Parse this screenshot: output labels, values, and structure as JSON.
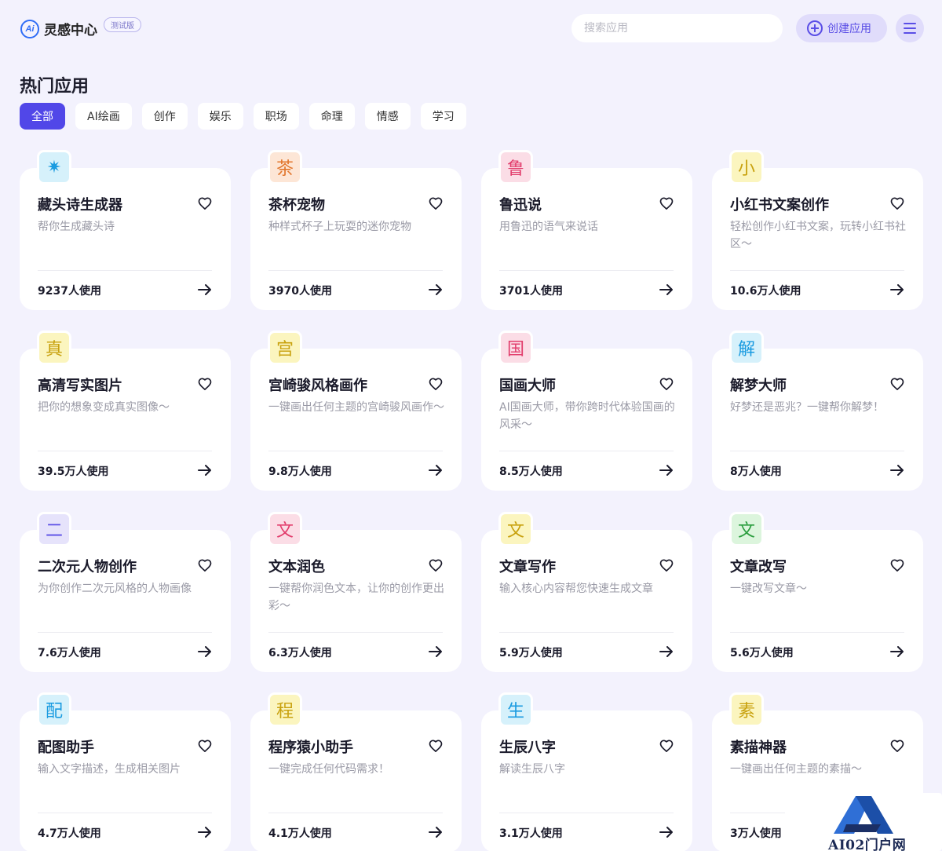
{
  "header": {
    "logo_mark": "Ai",
    "app_title": "灵感中心",
    "beta_badge": "测试版",
    "search_placeholder": "搜索应用",
    "create_button": "创建应用",
    "menu_icon": "hamburger-menu-icon"
  },
  "section_title": "热门应用",
  "tabs": [
    "全部",
    "AI绘画",
    "创作",
    "娱乐",
    "职场",
    "命理",
    "情感",
    "学习"
  ],
  "active_tab": "全部",
  "cards": [
    {
      "icon": "✷",
      "icon_color": "#1a9be0",
      "icon_bg": "#d6f1fb",
      "title": "藏头诗生成器",
      "desc": "帮你生成藏头诗",
      "usage": "9237人使用"
    },
    {
      "icon": "茶",
      "icon_color": "#e2772e",
      "icon_bg": "#fde6d6",
      "title": "茶杯宠物",
      "desc": "种样式杯子上玩耍的迷你宠物",
      "usage": "3970人使用"
    },
    {
      "icon": "鲁",
      "icon_color": "#e23d6c",
      "icon_bg": "#fbdde6",
      "title": "鲁迅说",
      "desc": "用鲁迅的语气来说话",
      "usage": "3701人使用"
    },
    {
      "icon": "小",
      "icon_color": "#c8a10e",
      "icon_bg": "#fbf5bf",
      "title": "小红书文案创作",
      "desc": "轻松创作小红书文案，玩转小红书社区～",
      "usage": "10.6万人使用"
    },
    {
      "icon": "真",
      "icon_color": "#c8a10e",
      "icon_bg": "#fbf5bf",
      "title": "高清写实图片",
      "desc": "把你的想象变成真实图像～",
      "usage": "39.5万人使用"
    },
    {
      "icon": "宫",
      "icon_color": "#c8a10e",
      "icon_bg": "#fbf5bf",
      "title": "宫崎骏风格画作",
      "desc": "一键画出任何主题的宫崎骏风画作～",
      "usage": "9.8万人使用"
    },
    {
      "icon": "国",
      "icon_color": "#e23d6c",
      "icon_bg": "#fbdde6",
      "title": "国画大师",
      "desc": "AI国画大师，带你跨时代体验国画的风采～",
      "usage": "8.5万人使用"
    },
    {
      "icon": "解",
      "icon_color": "#1a9be0",
      "icon_bg": "#d6f1fb",
      "title": "解梦大师",
      "desc": "好梦还是恶兆？一键帮你解梦！",
      "usage": "8万人使用"
    },
    {
      "icon": "二",
      "icon_color": "#5a4ee6",
      "icon_bg": "#e6e3fb",
      "title": "二次元人物创作",
      "desc": "为你创作二次元风格的人物画像",
      "usage": "7.6万人使用"
    },
    {
      "icon": "文",
      "icon_color": "#e23d6c",
      "icon_bg": "#fbdde6",
      "title": "文本润色",
      "desc": "一键帮你润色文本，让你的创作更出彩～",
      "usage": "6.3万人使用"
    },
    {
      "icon": "文",
      "icon_color": "#c8a10e",
      "icon_bg": "#fbf5bf",
      "title": "文章写作",
      "desc": "输入核心内容帮您快速生成文章",
      "usage": "5.9万人使用"
    },
    {
      "icon": "文",
      "icon_color": "#2a9d3e",
      "icon_bg": "#dcf5dd",
      "title": "文章改写",
      "desc": "一键改写文章～",
      "usage": "5.6万人使用"
    },
    {
      "icon": "配",
      "icon_color": "#1a9be0",
      "icon_bg": "#d6f1fb",
      "title": "配图助手",
      "desc": "输入文字描述，生成相关图片",
      "usage": "4.7万人使用"
    },
    {
      "icon": "程",
      "icon_color": "#c8a10e",
      "icon_bg": "#fbf5bf",
      "title": "程序猿小助手",
      "desc": "一键完成任何代码需求！",
      "usage": "4.1万人使用"
    },
    {
      "icon": "生",
      "icon_color": "#1a9be0",
      "icon_bg": "#d6f1fb",
      "title": "生辰八字",
      "desc": "解读生辰八字",
      "usage": "3.1万人使用"
    },
    {
      "icon": "素",
      "icon_color": "#c8a10e",
      "icon_bg": "#fbf5bf",
      "title": "素描神器",
      "desc": "一键画出任何主题的素描～",
      "usage": "3万人使用"
    }
  ],
  "watermark": {
    "text": "AI02门户网"
  },
  "colors": {
    "accent": "#5147e8",
    "background": "#f3f2fd",
    "card": "#ffffff"
  }
}
